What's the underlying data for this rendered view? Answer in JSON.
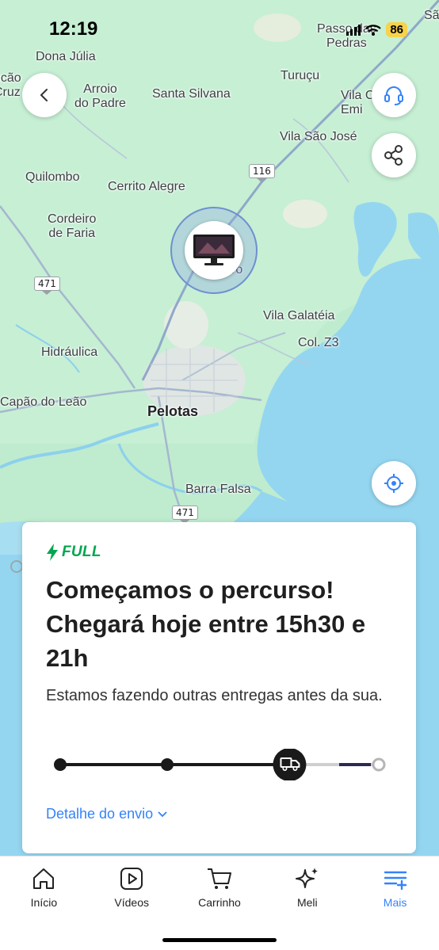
{
  "status_bar": {
    "time": "12:19",
    "battery": "86"
  },
  "map": {
    "places": [
      {
        "id": "dona-julia",
        "label": "Dona Júlia"
      },
      {
        "id": "conceicao",
        "label": "ncão\nCruz"
      },
      {
        "id": "arroio",
        "label": "Arroio\ndo Padre"
      },
      {
        "id": "santa-silvana",
        "label": "Santa Silvana"
      },
      {
        "id": "turucu",
        "label": "Turuçu"
      },
      {
        "id": "passo-pedras",
        "label": "Passo das\nPedras"
      },
      {
        "id": "vila-emi",
        "label": "Vila C\nEmi"
      },
      {
        "id": "vila-sao-jose",
        "label": "Vila São José"
      },
      {
        "id": "sa",
        "label": "Sã"
      },
      {
        "id": "quilombo",
        "label": "Quilombo"
      },
      {
        "id": "cerrito-alegre",
        "label": "Cerrito Alegre"
      },
      {
        "id": "cordeiro-faria",
        "label": "Cordeiro\nde Faria"
      },
      {
        "id": "monte-bonito",
        "label": "ro"
      },
      {
        "id": "vila-galateia",
        "label": "Vila Galatéia"
      },
      {
        "id": "col-z3",
        "label": "Col. Z3"
      },
      {
        "id": "hidraulica",
        "label": "Hidráulica"
      },
      {
        "id": "capao-leao",
        "label": "Capão do Leão"
      },
      {
        "id": "pelotas",
        "label": "Pelotas"
      },
      {
        "id": "barra-falsa",
        "label": "Barra Falsa"
      }
    ],
    "road_shields": [
      {
        "id": "br116",
        "label": "116"
      },
      {
        "id": "br471-a",
        "label": "471"
      },
      {
        "id": "br471-b",
        "label": "471"
      }
    ]
  },
  "card": {
    "badge": "FULL",
    "title": "Começamos o percurso! Chegará hoje entre 15h30 e 21h",
    "subtitle": "Estamos fazendo outras entregas antes da sua.",
    "progress_fraction": 0.72,
    "detail_link": "Detalhe do envio"
  },
  "nav": {
    "items": [
      {
        "label": "Início",
        "icon": "home-icon"
      },
      {
        "label": "Vídeos",
        "icon": "video-icon"
      },
      {
        "label": "Carrinho",
        "icon": "cart-icon"
      },
      {
        "label": "Meli",
        "icon": "sparkle-icon"
      },
      {
        "label": "Mais",
        "icon": "menu-plus-icon"
      }
    ],
    "active": "Mais"
  },
  "colors": {
    "accent_blue": "#3483fa",
    "full_green": "#00a650",
    "map_land": "#bfeccf",
    "map_water": "#94d6f0"
  }
}
